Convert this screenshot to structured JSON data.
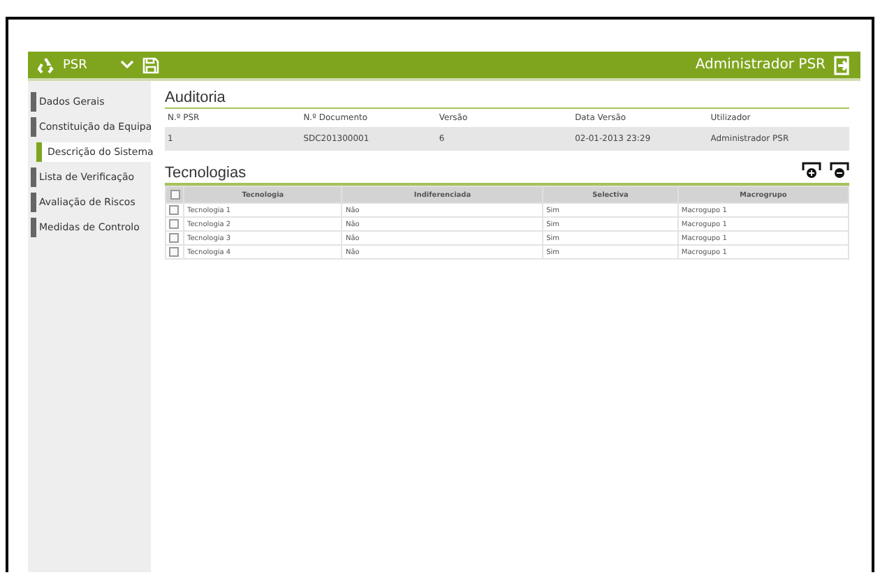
{
  "header": {
    "app_name": "PSR",
    "user": "Administrador PSR"
  },
  "sidebar": {
    "items": [
      {
        "label": "Dados Gerais",
        "selected": false
      },
      {
        "label": "Constituição da Equipa",
        "selected": false
      },
      {
        "label": "Descrição do Sistema",
        "selected": true
      },
      {
        "label": "Lista de Verificação",
        "selected": false
      },
      {
        "label": "Avaliação de Riscos",
        "selected": false
      },
      {
        "label": "Medidas de Controlo",
        "selected": false
      }
    ]
  },
  "auditoria": {
    "title": "Auditoria",
    "columns": [
      "N.º PSR",
      "N.º Documento",
      "Versão",
      "Data Versão",
      "Utilizador"
    ],
    "values": [
      "1",
      "SDC201300001",
      "6",
      "02-01-2013 23:29",
      "Administrador PSR"
    ]
  },
  "tecnologias": {
    "title": "Tecnologias",
    "all_checked": false,
    "columns": [
      "Tecnologia",
      "Indiferenciada",
      "Selectiva",
      "Macrogrupo"
    ],
    "rows": [
      {
        "checked": false,
        "cells": [
          "Tecnologia 1",
          "Não",
          "Sim",
          "Macrogupo 1"
        ]
      },
      {
        "checked": false,
        "cells": [
          "Tecnologia 2",
          "Não",
          "Sim",
          "Macrogupo 1"
        ]
      },
      {
        "checked": false,
        "cells": [
          "Tecnologia 3",
          "Não",
          "Sim",
          "Macrogupo 1"
        ]
      },
      {
        "checked": false,
        "cells": [
          "Tecnologia 4",
          "Não",
          "Sim",
          "Macrogupo 1"
        ]
      }
    ]
  }
}
